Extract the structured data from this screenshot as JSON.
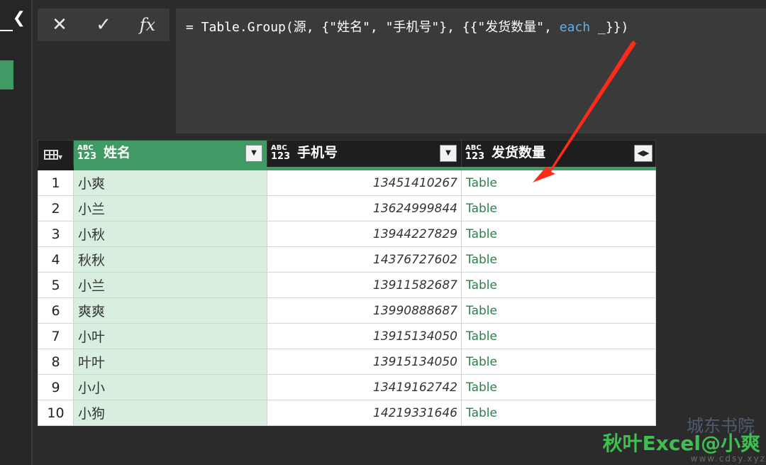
{
  "formula": {
    "prefix": "= Table.Group(源, {\"姓名\", \"手机号\"}, {{\"发货数量\", ",
    "keyword": "each",
    "suffix": " _}})"
  },
  "controls": {
    "cancel_icon": "close-icon",
    "confirm_icon": "check-icon",
    "fx_label": "fx"
  },
  "columns": [
    {
      "type_abc": "ABC",
      "type_123": "123",
      "name": "姓名"
    },
    {
      "type_abc": "ABC",
      "type_123": "123",
      "name": "手机号"
    },
    {
      "type_abc": "ABC",
      "type_123": "123",
      "name": "发货数量"
    }
  ],
  "rows": [
    {
      "num": "1",
      "name": "小爽",
      "phone": "13451410267",
      "value": "Table"
    },
    {
      "num": "2",
      "name": "小兰",
      "phone": "13624999844",
      "value": "Table"
    },
    {
      "num": "3",
      "name": "小秋",
      "phone": "13944227829",
      "value": "Table"
    },
    {
      "num": "4",
      "name": "秋秋",
      "phone": "14376727602",
      "value": "Table"
    },
    {
      "num": "5",
      "name": "小兰",
      "phone": "13911582687",
      "value": "Table"
    },
    {
      "num": "6",
      "name": "爽爽",
      "phone": "13990888687",
      "value": "Table"
    },
    {
      "num": "7",
      "name": "小叶",
      "phone": "13915134050",
      "value": "Table"
    },
    {
      "num": "8",
      "name": "叶叶",
      "phone": "13915134050",
      "value": "Table"
    },
    {
      "num": "9",
      "name": "小小",
      "phone": "13419162742",
      "value": "Table"
    },
    {
      "num": "10",
      "name": "小狗",
      "phone": "14219331646",
      "value": "Table"
    }
  ],
  "watermark": {
    "brand": "秋叶Excel@小爽",
    "site": "城东书院",
    "url": "www.cdsy.xyz"
  },
  "colors": {
    "accent_green": "#3f9a64",
    "keyword_blue": "#5fb0f0",
    "arrow_red": "#ff2a1a"
  }
}
